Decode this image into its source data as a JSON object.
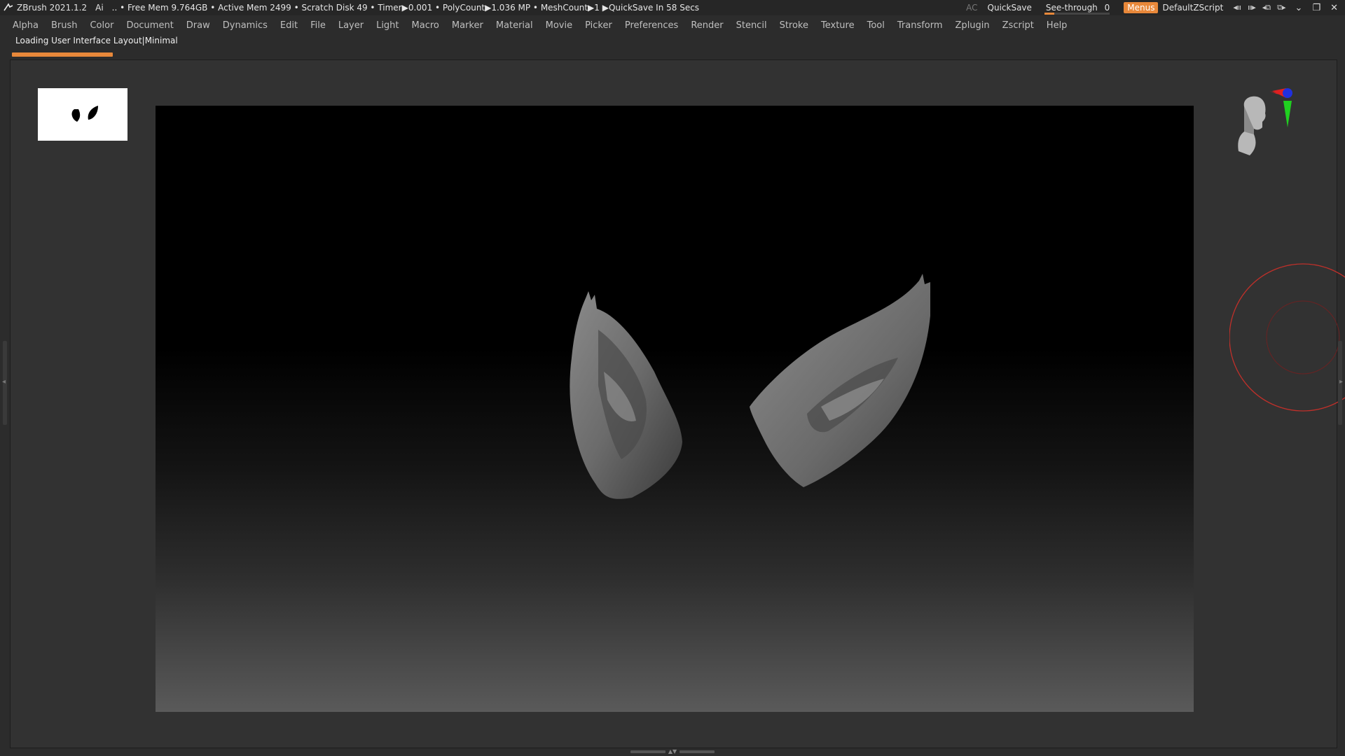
{
  "titlebar": {
    "app_title": "ZBrush 2021.1.2",
    "ai_label": "Ai",
    "stats": ".. • Free Mem 9.764GB • Active Mem 2499 • Scratch Disk 49 •  Timer▶0.001 • PolyCount▶1.036 MP  • MeshCount▶1  ▶QuickSave In 58 Secs",
    "ac_label": "AC",
    "quicksave_label": "QuickSave",
    "see_through_label": "See-through",
    "see_through_value": "0",
    "see_through_fraction": 0.0,
    "menus_label": "Menus",
    "script_label": "DefaultZScript",
    "icons": [
      "layout-prev-icon",
      "layout-next-icon",
      "popup-window-icon",
      "floating-window-icon",
      "minimize-icon",
      "restore-icon",
      "close-icon"
    ]
  },
  "menubar": {
    "items": [
      "Alpha",
      "Brush",
      "Color",
      "Document",
      "Draw",
      "Dynamics",
      "Edit",
      "File",
      "Layer",
      "Light",
      "Macro",
      "Marker",
      "Material",
      "Movie",
      "Picker",
      "Preferences",
      "Render",
      "Stencil",
      "Stroke",
      "Texture",
      "Tool",
      "Transform",
      "Zplugin",
      "Zscript",
      "Help"
    ]
  },
  "status": {
    "loading_text": "Loading User Interface Layout|Minimal"
  },
  "colors": {
    "accent": "#e8883a",
    "background": "#2c2c2c",
    "titlebar": "#262626",
    "menu_text": "#bfbfbf",
    "stroke_ring": "#c0302a",
    "axis_x": "#e02020",
    "axis_y": "#20d020",
    "axis_z": "#2030e0"
  },
  "viewport": {
    "alpha_preview_icon": "elf-ears-alpha-icon",
    "model_icon": "elf-ears-model-icon",
    "navigation_icon": "navigation-head-icon",
    "brush_ring_icon": "brush-draw-size-ring-icon"
  }
}
